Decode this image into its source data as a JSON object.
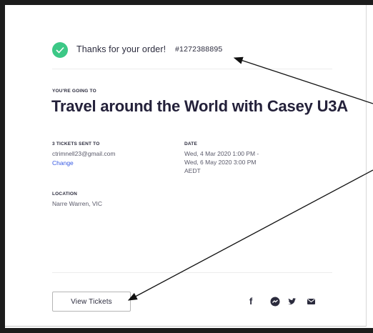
{
  "confirmation": {
    "thanks_text": "Thanks for your order!",
    "order_number": "#1272388895"
  },
  "event": {
    "eyebrow": "YOU'RE GOING TO",
    "title": "Travel around the World with Casey U3A"
  },
  "tickets": {
    "label": "3 TICKETS SENT TO",
    "email": "ctrimnell23@gmail.com",
    "change_link": "Change"
  },
  "date": {
    "label": "DATE",
    "line1": "Wed, 4 Mar 2020 1:00 PM -",
    "line2": "Wed, 6 May 2020 3:00 PM",
    "line3": "AEDT"
  },
  "location": {
    "label": "LOCATION",
    "value": "Narre Warren, VIC"
  },
  "actions": {
    "view_tickets_label": "View Tickets"
  },
  "social": {
    "facebook_glyph": "f"
  },
  "colors": {
    "success": "#3cc886",
    "link": "#3659e3",
    "title": "#24213a"
  }
}
